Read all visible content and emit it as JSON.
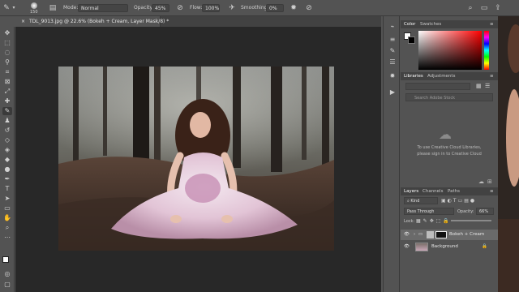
{
  "options_bar": {
    "brush_size": "150",
    "mode_label": "Mode:",
    "mode_value": "Normal",
    "opacity_label": "Opacity:",
    "opacity_value": "45%",
    "flow_label": "Flow:",
    "flow_value": "100%",
    "smoothing_label": "Smoothing:",
    "smoothing_value": "0%"
  },
  "document_tab": {
    "title": "TDL_9013.jpg @ 22.6% (Bokeh + Cream, Layer Mask/8) *",
    "close": "×"
  },
  "color_panel": {
    "tabs": [
      "Color",
      "Swatches"
    ],
    "accent_hue": "#ff0000"
  },
  "libraries_panel": {
    "tabs": [
      "Libraries",
      "Adjustments"
    ],
    "search_placeholder": "Search Adobe Stock",
    "message_line1": "To use Creative Cloud Libraries,",
    "message_line2": "please sign in to Creative Cloud"
  },
  "layers_panel": {
    "tabs": [
      "Layers",
      "Channels",
      "Paths"
    ],
    "filter_label": "Kind",
    "blend_mode": "Pass Through",
    "opacity_label": "Opacity:",
    "opacity_value": "66%",
    "lock_label": "Lock:",
    "layers": [
      {
        "name": "Bokeh + Cream",
        "type": "group"
      },
      {
        "name": "Background",
        "type": "image"
      }
    ]
  }
}
